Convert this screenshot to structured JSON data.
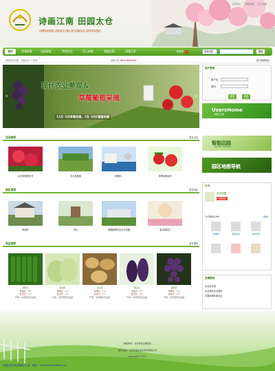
{
  "header": {
    "site_name": "诗画江南 田园太仓",
    "slogan": "[领略苏浙田园] [感受金光之美] [参与田园活动] [整体体验田园]",
    "top_links": [
      "会员中心",
      "网站地图",
      "加入收藏"
    ]
  },
  "nav": {
    "items": [
      {
        "label": "首页",
        "active": true
      },
      {
        "label": "农事采摘"
      },
      {
        "label": "田园体验"
      },
      {
        "label": "特色农品"
      },
      {
        "label": "网上商城"
      },
      {
        "label": "智能田园"
      },
      {
        "label": "风情之家"
      }
    ],
    "cart_label": "购物车",
    "cart_count": "0",
    "search_select": "搜索田园",
    "search_button": "搜索"
  },
  "crumb": {
    "path": "您现在的位置：田园太仓 > 首页",
    "notice_label": "最新公告",
    "notice_text": "NEW MESSAGE",
    "right_link": "热门采摘项目"
  },
  "banner": {
    "line1": "现代农业参观＆",
    "line2": "草莓葡萄采摘",
    "line3": "12月─5月草莓采摘、7月─10月葡萄采摘"
  },
  "login": {
    "title": "用户登录",
    "user_label": "用户名：",
    "pass_label": "密码：",
    "login_btn": "登录",
    "register_btn": "注册"
  },
  "side_ads": [
    {
      "title": "UsersHome",
      "sub": "网友之家"
    },
    {
      "title": "智能田园",
      "sub": "Smart Garden"
    },
    {
      "title": "园区地图导航",
      "sub": ""
    }
  ],
  "sections": {
    "activities": {
      "title": "活动推荐",
      "more": "更多活动"
    },
    "parks": {
      "title": "园区推荐",
      "more": "更多园区"
    },
    "products": {
      "title": "商品推荐",
      "more": "更多推荐"
    }
  },
  "activities": [
    "太仓玫瑰风情节",
    "农业品展销",
    "优雅参...",
    "草莓采摘活动"
  ],
  "parks": [
    "电瑞村",
    "党址",
    "城厢镇现代农业示范园",
    "金仓湖农庄"
  ],
  "products": [
    {
      "name": "【黄瓜】",
      "market": "市场价：2.0",
      "price": "会员价：1.6",
      "origin": "产地：太仓现代农业园"
    },
    {
      "name": "【白菜】",
      "market": "市场价：3.0",
      "price": "会员价：3.0",
      "origin": "产地：太仓现代农业园"
    },
    {
      "name": "【土豆】",
      "market": "市场价：1.2",
      "price": "会员价：0.7",
      "origin": "产地：太仓现代农业园"
    },
    {
      "name": "【茄子】",
      "market": "市场价：2.5",
      "price": "会员价：2.5",
      "origin": "产地：太仓现代农业园"
    },
    {
      "name": "【葡萄】",
      "market": "市场价：4.0",
      "price": "会员价：3.8",
      "origin": "产地：太仓现代农业园"
    }
  ],
  "weibo": {
    "header": "微博",
    "user": "太仓田园",
    "follow": "加关注",
    "fans_label": "TA 的粉丝(96)",
    "all": "全部»",
    "fans": [
      "李华明",
      "阿菜某某",
      "满仓天涯",
      "",
      "",
      ""
    ]
  },
  "friends": {
    "title": "友情链接",
    "links": [
      "太仓农业网",
      "太仓现代农业园区",
      "中国影像科普社区"
    ]
  },
  "footer": {
    "line1": "版权所有：太仓市农业委员会",
    "line2": "技术支持：江苏佳盛达电子商务有限公司",
    "line3": "Copyright © 2011"
  },
  "bottom_note": "本图片由\"网页模板\"生成，网址：http://www.5Ptools.cn",
  "colors": {
    "primary_green": "#6fb432",
    "title_green": "#3a7c16",
    "price_red": "#c33"
  }
}
